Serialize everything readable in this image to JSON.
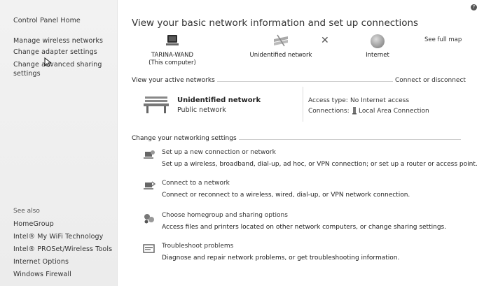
{
  "sidebar": {
    "links": [
      {
        "label": "Control Panel Home",
        "name": "control-panel-home-link"
      },
      {
        "label": "Manage wireless networks",
        "name": "manage-wireless-networks-link"
      },
      {
        "label": "Change adapter settings",
        "name": "change-adapter-settings-link"
      },
      {
        "label": "Change advanced sharing settings",
        "name": "change-advanced-sharing-link"
      }
    ],
    "see_also_title": "See also",
    "see_also": [
      {
        "label": "HomeGroup",
        "name": "homegroup-link"
      },
      {
        "label": "Intel® My WiFi Technology",
        "name": "intel-my-wifi-link"
      },
      {
        "label": "Intel® PROSet/Wireless Tools",
        "name": "intel-proset-link"
      },
      {
        "label": "Internet Options",
        "name": "internet-options-link"
      },
      {
        "label": "Windows Firewall",
        "name": "windows-firewall-link"
      }
    ]
  },
  "main": {
    "title": "View your basic network information and set up connections",
    "see_full_map": "See full map",
    "map": {
      "computer_name": "TARINA-WAND",
      "computer_sub": "(This computer)",
      "network": "Unidentified network",
      "internet": "Internet"
    },
    "active_networks": {
      "label": "View your active networks",
      "connect_disconnect": "Connect or disconnect",
      "network_name": "Unidentified network",
      "network_type": "Public network",
      "access_type_key": "Access type:",
      "access_type_val": "No Internet access",
      "connections_key": "Connections:",
      "connections_val": "Local Area Connection"
    },
    "change_settings": {
      "label": "Change your networking settings",
      "tasks": [
        {
          "title": "Set up a new connection or network",
          "desc": "Set up a wireless, broadband, dial-up, ad hoc, or VPN connection; or set up a router or access point."
        },
        {
          "title": "Connect to a network",
          "desc": "Connect or reconnect to a wireless, wired, dial-up, or VPN network connection."
        },
        {
          "title": "Choose homegroup and sharing options",
          "desc": "Access files and printers located on other network computers, or change sharing settings."
        },
        {
          "title": "Troubleshoot problems",
          "desc": "Diagnose and repair network problems, or get troubleshooting information."
        }
      ]
    }
  },
  "icons": {
    "help": "help-icon",
    "computer": "computer-icon",
    "network": "network-icon",
    "disconnected": "x-icon",
    "internet": "globe-icon",
    "bench": "bench-icon",
    "cursor": "cursor-icon"
  }
}
